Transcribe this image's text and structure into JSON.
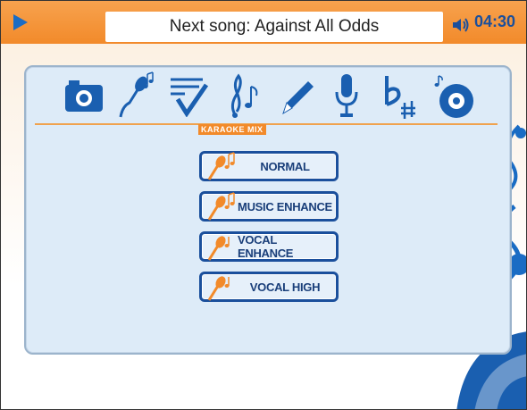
{
  "header": {
    "next_song": "Next song: Against All Odds",
    "time": "04:30"
  },
  "toolbar": {
    "icons": [
      "camera-icon",
      "karaoke-mic-icon",
      "checklist-icon",
      "music-note-icon",
      "pencil-icon",
      "microphone-icon",
      "key-flat-sharp-icon",
      "disc-icon"
    ],
    "active_label": "KARAOKE MIX"
  },
  "options": [
    {
      "label": "NORMAL"
    },
    {
      "label": "MUSIC ENHANCE"
    },
    {
      "label": "VOCAL ENHANCE"
    },
    {
      "label": "VOCAL HIGH"
    }
  ],
  "colors": {
    "accent": "#f28a2a",
    "primary": "#1a4f9c",
    "panel": "#ddebf8"
  }
}
